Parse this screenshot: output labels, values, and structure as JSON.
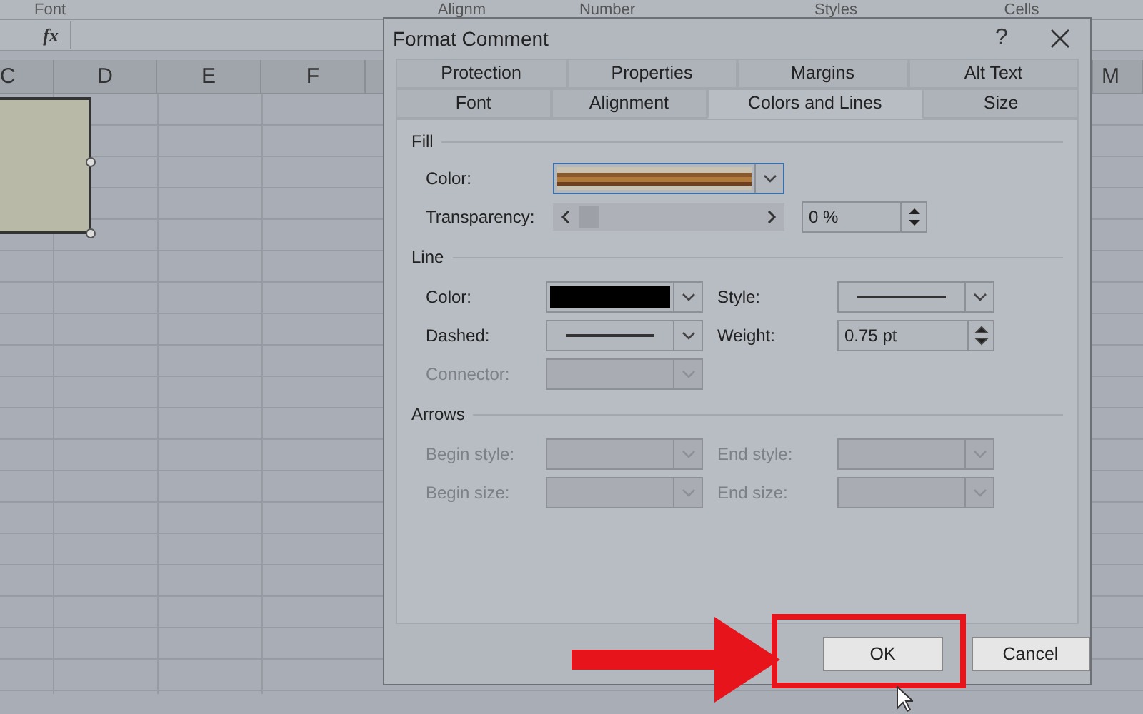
{
  "ribbon": {
    "groups": [
      "Font",
      "Alignm",
      "Number",
      "Styles",
      "Cells"
    ]
  },
  "formula_bar": {
    "function_symbol": "fx"
  },
  "columns": [
    "C",
    "D",
    "E",
    "F",
    "M"
  ],
  "dialog": {
    "title": "Format Comment",
    "help": "?",
    "tab_rows": [
      [
        {
          "label": "Protection",
          "selected": false
        },
        {
          "label": "Properties",
          "selected": false
        },
        {
          "label": "Margins",
          "selected": false
        },
        {
          "label": "Alt Text",
          "selected": false
        }
      ],
      [
        {
          "label": "Font",
          "selected": false
        },
        {
          "label": "Alignment",
          "selected": false
        },
        {
          "label": "Colors and Lines",
          "selected": true
        },
        {
          "label": "Size",
          "selected": false
        }
      ]
    ],
    "fill": {
      "heading": "Fill",
      "color_label": "Color:",
      "transparency_label": "Transparency:",
      "transparency": {
        "level": 0
      },
      "transparency_value": "0 %"
    },
    "line": {
      "heading": "Line",
      "fields": [
        {
          "label": "Color:",
          "kind": "color",
          "disabled": false
        },
        {
          "label": "Style:",
          "kind": "line",
          "disabled": false
        },
        {
          "label": "Dashed:",
          "kind": "line",
          "disabled": false
        },
        {
          "label": "Weight:",
          "kind": "spinner",
          "value": "0.75 pt",
          "disabled": false
        },
        {
          "label": "Connector:",
          "kind": "dropdown",
          "disabled": true
        }
      ]
    },
    "arrows": {
      "heading": "Arrows",
      "fields": [
        {
          "label": "Begin style:",
          "kind": "dropdown",
          "disabled": true
        },
        {
          "label": "End style:",
          "kind": "dropdown",
          "disabled": true
        },
        {
          "label": "Begin size:",
          "kind": "dropdown",
          "disabled": true
        },
        {
          "label": "End size:",
          "kind": "dropdown",
          "disabled": true
        }
      ]
    },
    "buttons": [
      {
        "label": "OK",
        "highlighted": true
      },
      {
        "label": "Cancel",
        "highlighted": false
      }
    ]
  }
}
